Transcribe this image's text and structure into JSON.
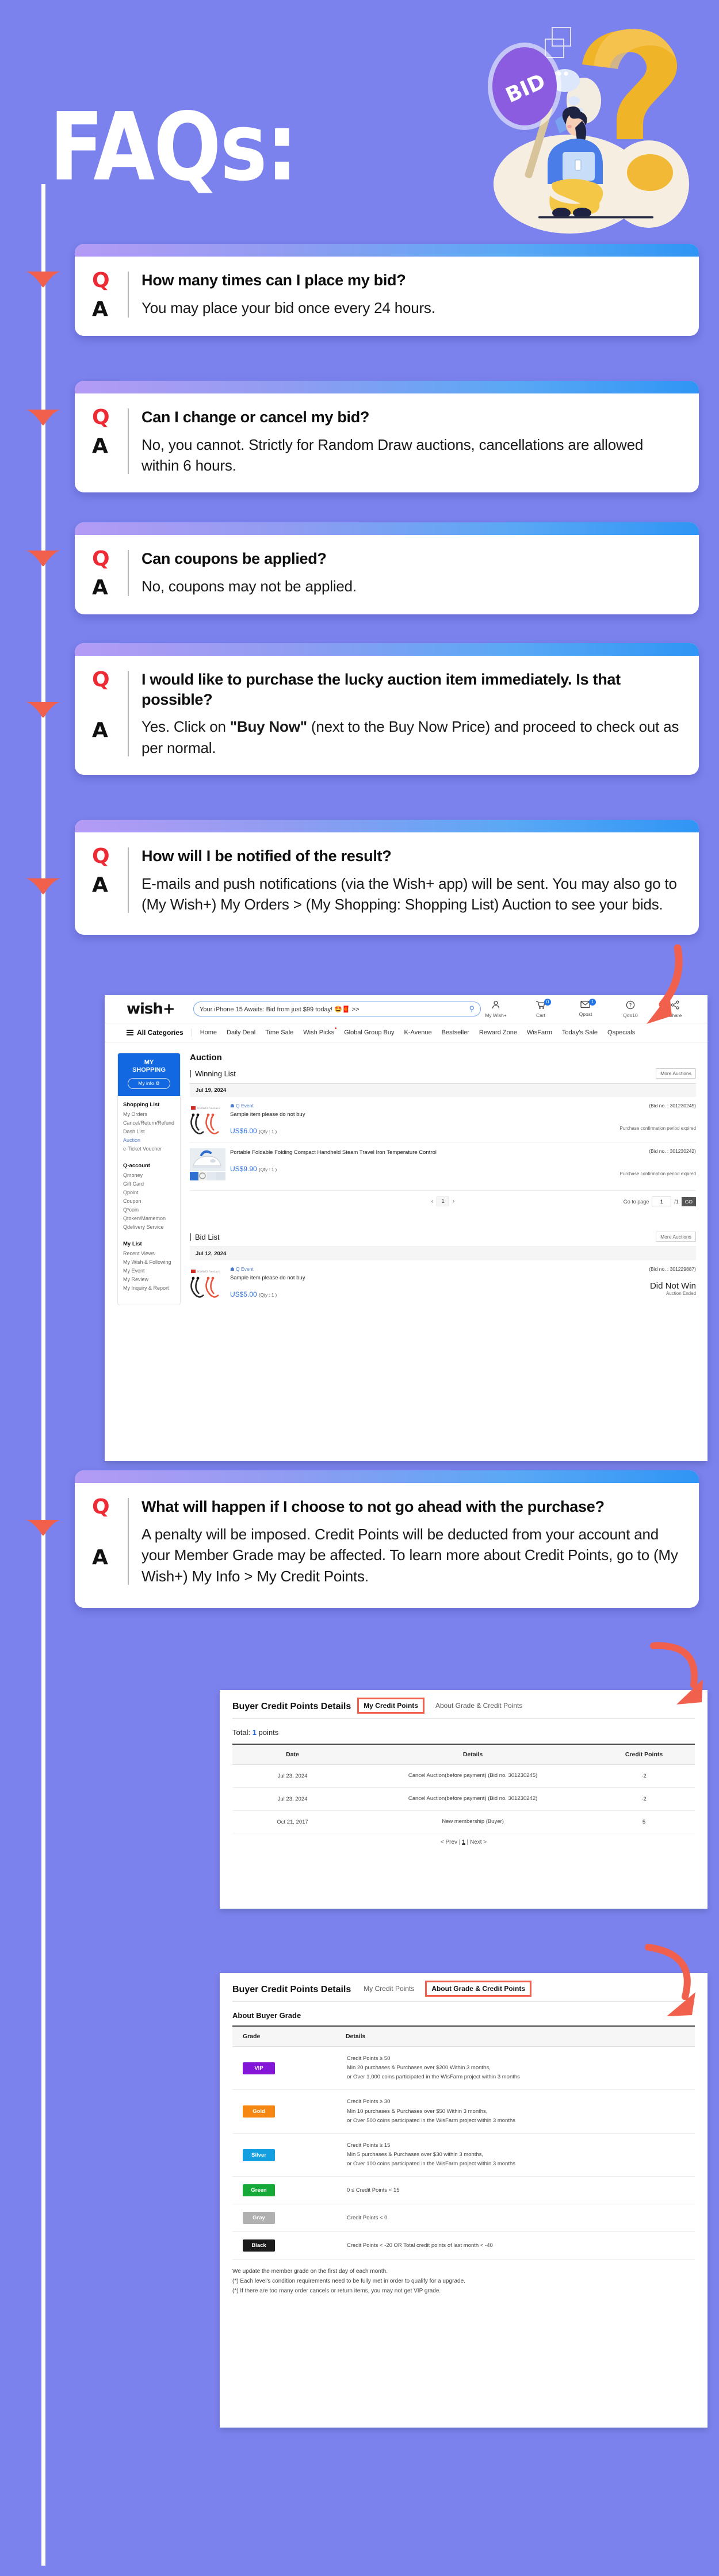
{
  "header": {
    "title": "FAQs:",
    "bid_badge": "BID"
  },
  "faqs": [
    {
      "q_label": "Q",
      "a_label": "A",
      "question": "How many times can I place my bid?",
      "answer": "You may place your bid once every 24 hours."
    },
    {
      "q_label": "Q",
      "a_label": "A",
      "question": "Can I change or cancel my bid?",
      "answer": "No, you cannot. Strictly for Random Draw auctions, cancellations are allowed within 6 hours."
    },
    {
      "q_label": "Q",
      "a_label": "A",
      "question": "Can coupons be applied?",
      "answer": "No, coupons may not be applied."
    },
    {
      "q_label": "Q",
      "a_label": "A",
      "question": "I would like to purchase the lucky auction item immediately. Is that possible?",
      "answer_pre": "Yes. Click on ",
      "answer_bold": "\"Buy Now\"",
      "answer_post": " (next to the Buy Now Price) and proceed to check out as per normal."
    },
    {
      "q_label": "Q",
      "a_label": "A",
      "question": "How will I be notified of the result?",
      "answer": "E-mails and push notifications (via the Wish+ app) will be sent. You may also go to (My Wish+) My Orders > (My Shopping: Shopping List) Auction to see your bids."
    },
    {
      "q_label": "Q",
      "a_label": "A",
      "question": "What will happen if I choose to not go ahead with the purchase?",
      "answer": "A penalty will be imposed. Credit Points will be deducted from your account and your Member Grade may be affected. To learn more about Credit Points, go to (My Wish+) My Info > My Credit Points."
    }
  ],
  "wish_screenshot": {
    "logo": "wish+",
    "search_value": "Your iPhone 15 Awaits: Bid from just $99 today! 🤩🧧 >>",
    "search_icon": "search-icon",
    "top_icons": [
      {
        "label": "My Wish+",
        "icon": "person-icon",
        "badge": ""
      },
      {
        "label": "Cart",
        "icon": "cart-icon",
        "badge": "0"
      },
      {
        "label": "Qpost",
        "icon": "envelope-icon",
        "badge": "1"
      },
      {
        "label": "Qoo10",
        "icon": "help-icon",
        "badge": ""
      },
      {
        "label": "Share",
        "icon": "share-icon",
        "badge": ""
      }
    ],
    "nav": {
      "all_categories": "All Categories",
      "items": [
        "Home",
        "Daily Deal",
        "Time Sale",
        "Wish Picks",
        "Global Group Buy",
        "K-Avenue",
        "Bestseller",
        "Reward Zone",
        "WisFarm",
        "Today's Sale",
        "Qspecials"
      ]
    },
    "sidebar": {
      "title_line1": "MY",
      "title_line2": "SHOPPING",
      "my_info": "My info",
      "groups": [
        {
          "heading": "Shopping List",
          "items": [
            "My Orders",
            "Cancel/Return/Refund",
            "Dash List",
            "Auction",
            "e-Ticket Voucher"
          ],
          "active": "Auction"
        },
        {
          "heading": "Q-account",
          "items": [
            "Qmoney",
            "Gift Card",
            "Qpoint",
            "Coupon",
            "Q*coin",
            "Qtoken/Mamemon",
            "Qdelivery Service"
          ],
          "active": ""
        },
        {
          "heading": "My List",
          "items": [
            "Recent Views",
            "My Wish & Following",
            "My Event",
            "My Review",
            "My Inquiry & Report"
          ],
          "active": ""
        }
      ]
    },
    "page_title": "Auction",
    "winning": {
      "section_title": "Winning List",
      "more_button": "More Auctions",
      "date": "Jul 19, 2024",
      "rows": [
        {
          "tag": "Q Event",
          "name": "Sample item please do not buy",
          "price": "US$6.00",
          "qty": "(Qty : 1 )",
          "bid_no": "(Bid no. : 301230245)",
          "status": "Purchase confirmation period expired",
          "thumb": "earbuds"
        },
        {
          "tag": "",
          "name": "Portable Foldable Folding Compact Handheld Steam Travel Iron Temperature Control",
          "price": "US$9.90",
          "qty": "(Qty : 1 )",
          "bid_no": "(Bid no. : 301230242)",
          "status": "Purchase confirmation period expired",
          "thumb": "iron"
        }
      ],
      "pager": {
        "prev": "‹",
        "page": "1",
        "next": "›",
        "goto_label": "Go to page",
        "goto_value": "1",
        "total": "/1",
        "go": "GO"
      }
    },
    "bidlist": {
      "section_title": "Bid List",
      "more_button": "More Auctions",
      "date": "Jul 12, 2024",
      "rows": [
        {
          "tag": "Q Event",
          "name": "Sample item please do not buy",
          "price": "US$5.00",
          "qty": "(Qty : 1 )",
          "bid_no": "(Bid no. : 301229887)",
          "status_big": "Did Not Win",
          "status_small": "Auction Ended",
          "thumb": "earbuds"
        }
      ]
    }
  },
  "credit_points_panel": {
    "title": "Buyer Credit Points Details",
    "tabs": [
      "My Credit Points",
      "About Grade & Credit Points"
    ],
    "selected_tab": "My Credit Points",
    "total_label_pre": "Total: ",
    "total_value": "1",
    "total_label_post": " points",
    "columns": [
      "Date",
      "Details",
      "Credit Points"
    ],
    "rows": [
      {
        "date": "Jul 23, 2024",
        "details": "Cancel Auction(before payment) (Bid no. 301230245)",
        "points": "-2"
      },
      {
        "date": "Jul 23, 2024",
        "details": "Cancel Auction(before payment) (Bid no. 301230242)",
        "points": "-2"
      },
      {
        "date": "Oct 21, 2017",
        "details": "New membership (Buyer)",
        "points": "5"
      }
    ],
    "pager": {
      "prev": "< Prev |",
      "current": "1",
      "next": "| Next >"
    }
  },
  "grade_panel": {
    "title": "Buyer Credit Points Details",
    "tabs": [
      "My Credit Points",
      "About Grade & Credit Points"
    ],
    "selected_tab": "About Grade & Credit Points",
    "subtitle": "About Buyer Grade",
    "columns": [
      "Grade",
      "Details"
    ],
    "rows": [
      {
        "grade": "VIP",
        "color": "#8315d6",
        "details": "Credit Points ≥ 50\nMin 20 purchases & Purchases over $200 Within 3 months,\nor Over 1,000 coins participated in the WisFarm project within 3 months"
      },
      {
        "grade": "Gold",
        "color": "#f68712",
        "details": "Credit Points ≥ 30\nMin 10 purchases & Purchases over $50 Within 3 months,\nor Over 500 coins participated in the WisFarm project within 3 months"
      },
      {
        "grade": "Silver",
        "color": "#14a0e0",
        "details": "Credit Points ≥ 15\nMin 5 purchases & Purchases over $30 within 3 months,\nor Over 100 coins participated in the WisFarm project within 3 months"
      },
      {
        "grade": "Green",
        "color": "#17a938",
        "details": "0 ≤ Credit Points < 15"
      },
      {
        "grade": "Gray",
        "color": "#b0b0b0",
        "details": "Credit Points < 0"
      },
      {
        "grade": "Black",
        "color": "#1b1b1b",
        "details": "Credit Points < -20 OR Total credit points of last month < -40"
      }
    ],
    "notes": [
      "We update the member grade on the first day of each month.",
      "(*) Each level's condition requirements need to be fully met in order to qualify for a upgrade.",
      "(*) If there are too many order cancels or return items, you may not get VIP grade."
    ]
  },
  "colors": {
    "background": "#7b82ed",
    "accent_orange": "#f0604d",
    "q_red": "#ed2b35",
    "link_blue": "#2968d8",
    "card_stripe_from": "#b49bf5",
    "card_stripe_to": "#2f95f5"
  }
}
